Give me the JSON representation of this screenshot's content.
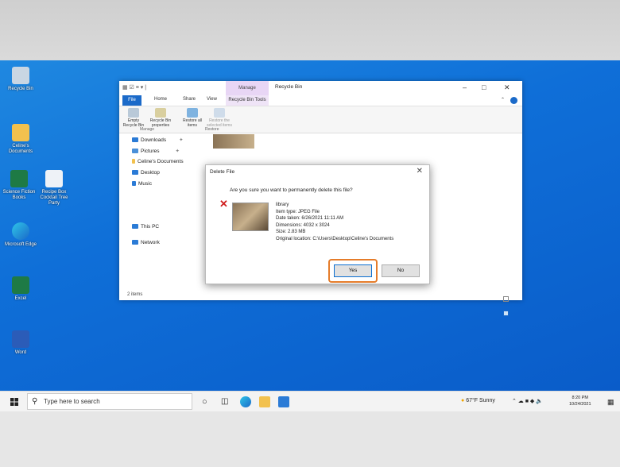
{
  "desktop_icons": [
    {
      "label": "Recycle Bin",
      "icon": "recycle-bin-icon"
    },
    {
      "label": "Celine's Documents",
      "icon": "folder-icon"
    },
    {
      "label": "Science Fiction Books",
      "icon": "excel-file-icon"
    },
    {
      "label": "Recipe Box Cocktail Tree Party",
      "icon": "document-icon"
    },
    {
      "label": "Microsoft Edge",
      "icon": "edge-icon"
    },
    {
      "label": "Excel",
      "icon": "excel-icon"
    },
    {
      "label": "Word",
      "icon": "word-icon"
    }
  ],
  "explorer": {
    "context_tab": "Manage",
    "title": "Recycle Bin",
    "tabs": [
      "File",
      "Home",
      "Share",
      "View",
      "Recycle Bin Tools"
    ],
    "ribbon_buttons": [
      "Empty Recycle Bin",
      "Recycle Bin properties",
      "Restore all items",
      "Restore the selected items"
    ],
    "groups": [
      "Manage",
      "Restore"
    ],
    "nav_items": [
      "Downloads",
      "Pictures",
      "Celine's Documents",
      "Desktop",
      "Music",
      "This PC",
      "Network"
    ],
    "status": "2 items"
  },
  "dialog": {
    "title": "Delete File",
    "question": "Are you sure you want to permanently delete this file?",
    "file_name": "library",
    "item_type": "Item type: JPEG File",
    "date_taken": "Date taken: 6/26/2021 11:11 AM",
    "dimensions": "Dimensions: 4032 x 3024",
    "size": "Size: 2.83 MB",
    "location": "Original location: C:\\Users\\Desktop\\Celine's Documents",
    "yes": "Yes",
    "no": "No"
  },
  "taskbar": {
    "search_placeholder": "Type here to search",
    "weather": "67°F  Sunny",
    "time": "8:20 PM",
    "date": "10/24/2021"
  },
  "colors": {
    "desktop": "#0f6fd8",
    "accent": "#1b6ac9",
    "highlight": "#e57c2a",
    "delete_x": "#d02020"
  }
}
